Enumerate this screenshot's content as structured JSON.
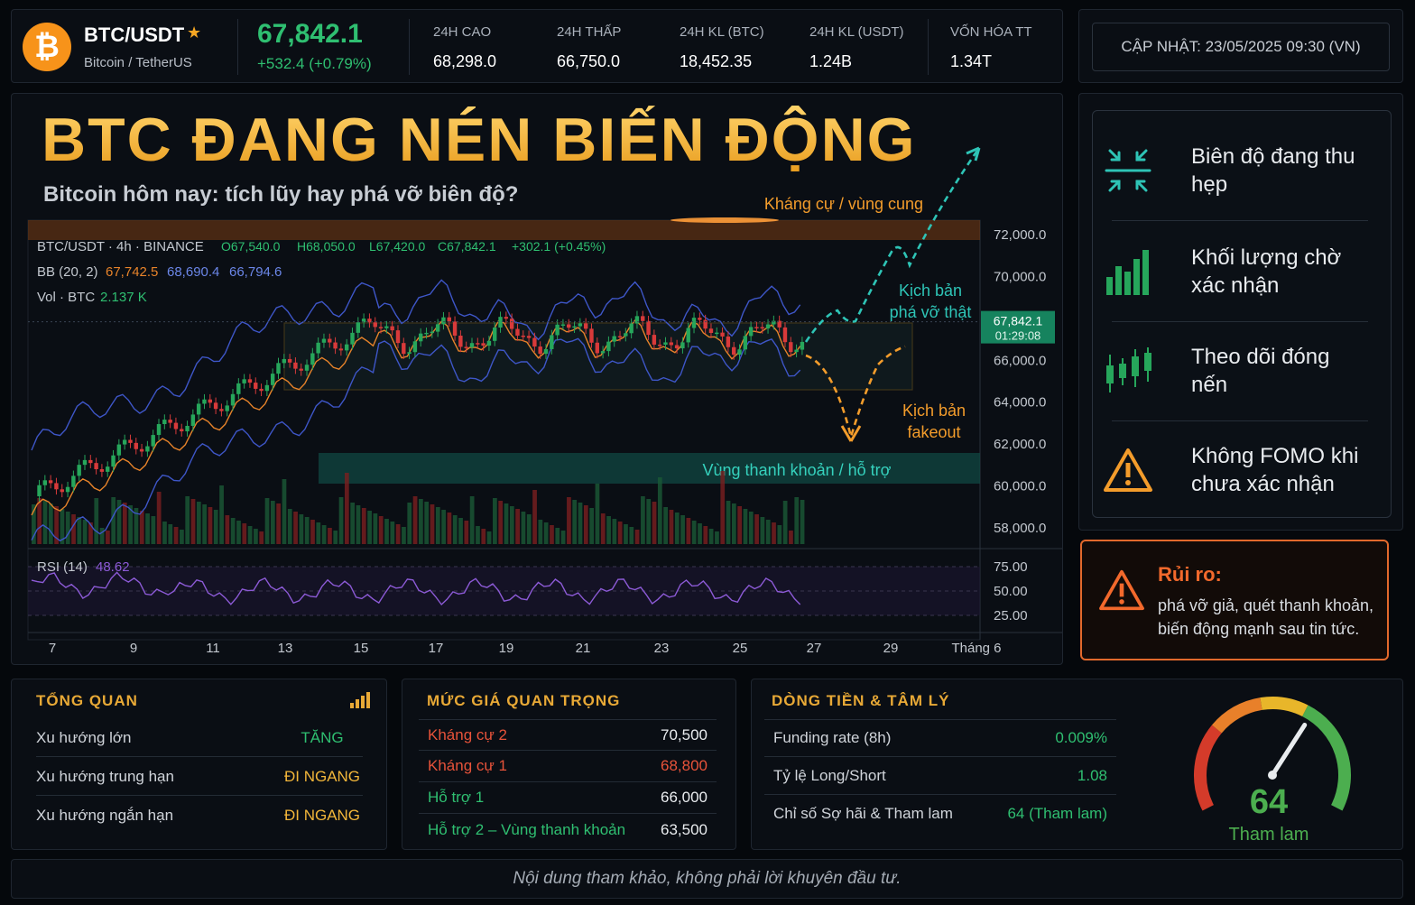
{
  "ticker": {
    "symbol": "BTC/USDT",
    "name": "Bitcoin / TetherUS",
    "price": "67,842.1",
    "change": "+532.4  (+0.79%)",
    "stats": [
      {
        "label": "24H CAO",
        "value": "68,298.0"
      },
      {
        "label": "24H THẤP",
        "value": "66,750.0"
      },
      {
        "label": "24H KL (BTC)",
        "value": "18,452.35"
      },
      {
        "label": "24H KL (USDT)",
        "value": "1.24B"
      },
      {
        "label": "VỐN HÓA TT",
        "value": "1.34T"
      }
    ],
    "coin_icon": "bitcoin-icon",
    "favorite_icon": "star-icon"
  },
  "update": {
    "label": "CẬP NHẬT: 23/05/2025 09:30 (VN)"
  },
  "hero": {
    "title": "BTC ĐANG NÉN BIẾN ĐỘNG",
    "subtitle": "Bitcoin hôm nay: tích lũy hay phá vỡ biên độ?"
  },
  "chart_data": {
    "type": "candlestick",
    "legend": {
      "pair_line": "BTC/USDT · 4h · BINANCE",
      "open": "O67,540.0",
      "high": "H68,050.0",
      "low": "L67,420.0",
      "close": "C67,842.1",
      "change": "+302.1 (+0.45%)",
      "bb_label": "BB (20, 2)",
      "bb_values": [
        "67,742.5",
        "68,690.4",
        "66,794.6"
      ],
      "vol_label": "Vol · BTC",
      "vol_value": "2.137 K"
    },
    "price_axis": [
      "72,000.0",
      "70,000.0",
      "68,000.0",
      "66,000.0",
      "64,000.0",
      "62,000.0",
      "60,000.0",
      "58,000.0"
    ],
    "price_range": [
      57300,
      72700
    ],
    "current_price_tag": {
      "price": "67,842.1",
      "timer": "01:29:08"
    },
    "x_axis": [
      "7",
      "9",
      "11",
      "13",
      "15",
      "17",
      "19",
      "21",
      "23",
      "25",
      "27",
      "29",
      "Tháng 6"
    ],
    "rsi": {
      "label": "RSI (14)",
      "value": "48.62",
      "ticks": [
        "75.00",
        "50.00",
        "25.00"
      ]
    },
    "zones": {
      "resistance": "Kháng cự / vùng cung",
      "support": "Vùng thanh khoản / hỗ trợ",
      "breakout": "Kịch bản phá vỡ thật",
      "fakeout": "Kịch bản fakeout"
    },
    "colors": {
      "up": "#26a65b",
      "down": "#d83a3a",
      "bb": "#3e56c8",
      "ma": "#e7832a",
      "rsi": "#8c5ad6",
      "breakout": "#2ec4b6",
      "fakeout": "#f39c2b"
    }
  },
  "side": {
    "items": [
      {
        "text": "Biên độ đang thu hẹp",
        "icon": "compress-icon"
      },
      {
        "text": "Khối lượng chờ xác nhận",
        "icon": "volume-bars-icon"
      },
      {
        "text": "Theo dõi đóng nến",
        "icon": "candles-icon"
      },
      {
        "text": "Không FOMO khi chưa xác nhận",
        "icon": "warning-icon"
      }
    ]
  },
  "risk": {
    "title": "Rủi ro:",
    "text": "phá vỡ giả, quét thanh khoản, biến động mạnh sau tin tức."
  },
  "overview": {
    "title": "TỔNG QUAN",
    "rows": [
      {
        "k": "Xu hướng lớn",
        "v": "TĂNG",
        "color": "#2fbf71"
      },
      {
        "k": "Xu hướng trung hạn",
        "v": "ĐI NGANG",
        "color": "#f2b63a"
      },
      {
        "k": "Xu hướng ngắn hạn",
        "v": "ĐI NGANG",
        "color": "#f2b63a"
      }
    ]
  },
  "levels": {
    "title": "MỨC GIÁ QUAN TRỌNG",
    "rows": [
      {
        "k": "Kháng cự 2",
        "v": "70,500",
        "kc": "#e8533a",
        "vc": "#e9ecef"
      },
      {
        "k": "Kháng cự 1",
        "v": "68,800",
        "kc": "#e8533a",
        "vc": "#e8533a"
      },
      {
        "k": "Hỗ trợ 1",
        "v": "66,000",
        "kc": "#2fbf71",
        "vc": "#e9ecef"
      },
      {
        "k": "Hỗ trợ 2 – Vùng thanh khoản",
        "v": "63,500",
        "kc": "#2fbf71",
        "vc": "#e9ecef"
      }
    ]
  },
  "flow": {
    "title": "DÒNG TIỀN & TÂM LÝ",
    "rows": [
      {
        "k": "Funding rate (8h)",
        "v": "0.009%"
      },
      {
        "k": "Tỷ lệ Long/Short",
        "v": "1.08"
      },
      {
        "k": "Chỉ số Sợ hãi & Tham lam",
        "v": "64 (Tham lam)"
      }
    ],
    "gauge": {
      "value": 64,
      "label": "Tham lam"
    }
  },
  "footer": {
    "text": "Nội dung tham khảo, không phải lời khuyên đầu tư."
  }
}
